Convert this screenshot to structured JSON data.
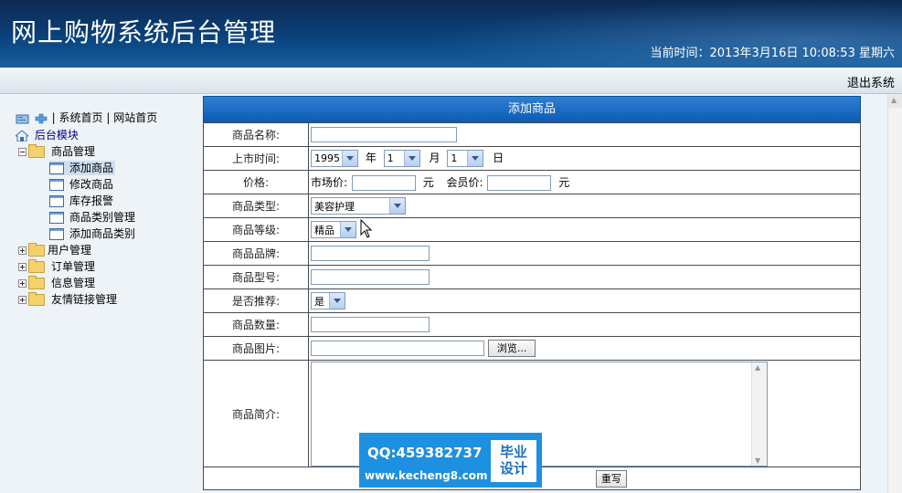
{
  "header": {
    "title": "网上购物系统后台管理",
    "datetime": "当前时间：2013年3月16日  10:08:53 星期六",
    "logout_label": "退出系统"
  },
  "sidebar": {
    "top_links": [
      "系统首页",
      "网站首页"
    ],
    "root_label": "后台模块",
    "groups": [
      {
        "label": "商品管理",
        "expanded": true,
        "items": [
          "添加商品",
          "修改商品",
          "库存报警",
          "商品类别管理",
          "添加商品类别"
        ]
      },
      {
        "label": "用户管理",
        "expanded": false
      },
      {
        "label": "订单管理",
        "expanded": false
      },
      {
        "label": "信息管理",
        "expanded": false
      },
      {
        "label": "友情链接管理",
        "expanded": false
      }
    ],
    "selected_item": "添加商品"
  },
  "form": {
    "title": "添加商品",
    "fields": {
      "name_label": "商品名称:",
      "date_label": "上市时间:",
      "year_value": "1995",
      "year_unit": "年",
      "month_value": "1",
      "month_unit": "月",
      "day_value": "1",
      "day_unit": "日",
      "price_label": "价格:",
      "market_price_label": "市场价:",
      "member_price_label": "会员价:",
      "yuan_unit": "元",
      "type_label": "商品类型:",
      "type_value": "美容护理",
      "grade_label": "商品等级:",
      "grade_value": "精品",
      "brand_label": "商品品牌:",
      "model_label": "商品型号:",
      "recommend_label": "是否推荐:",
      "recommend_value": "是",
      "quantity_label": "商品数量:",
      "image_label": "商品图片:",
      "browse_label": "浏览...",
      "intro_label": "商品简介:",
      "reset_label": "重写"
    }
  },
  "watermark": {
    "qq": "QQ:459382737",
    "url": "www.kecheng8.com",
    "stamp_line1": "毕业",
    "stamp_line2": "设计"
  }
}
